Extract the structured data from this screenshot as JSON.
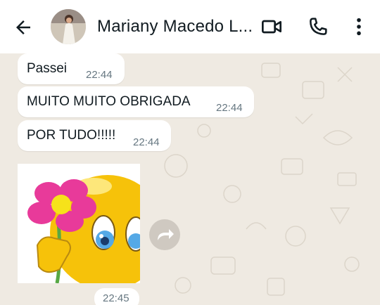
{
  "header": {
    "title": "Mariany Macedo L...",
    "back_icon": "arrow-left-icon",
    "video_icon": "video-camera-icon",
    "call_icon": "phone-icon",
    "menu_icon": "more-vertical-icon"
  },
  "messages": [
    {
      "text": "Passei",
      "time": "22:44"
    },
    {
      "text": "MUITO MUITO OBRIGADA",
      "time": "22:44"
    },
    {
      "text": "POR TUDO!!!!!",
      "time": "22:44"
    }
  ],
  "sticker": {
    "time": "22:45",
    "forward_icon": "forward-icon"
  },
  "colors": {
    "header_bg": "#ffffff",
    "chat_bg": "#efeae2",
    "bubble_bg": "#ffffff",
    "text": "#111b21",
    "time": "#667781"
  }
}
